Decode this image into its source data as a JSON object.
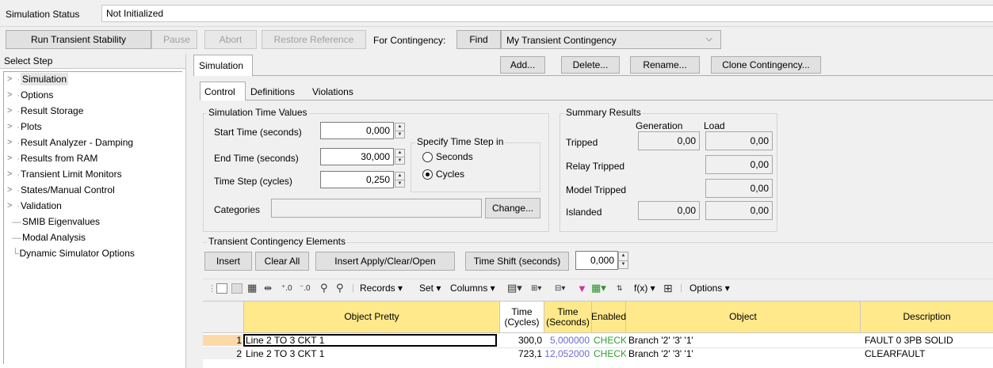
{
  "status": {
    "label": "Simulation Status",
    "value": "Not Initialized"
  },
  "toolbar": {
    "run": "Run Transient Stability",
    "pause": "Pause",
    "abort": "Abort",
    "restore": "Restore Reference",
    "for_contingency": "For Contingency:",
    "find": "Find",
    "contingency_value": "My Transient Contingency"
  },
  "select_step": {
    "title": "Select Step",
    "items": [
      "Simulation",
      "Options",
      "Result Storage",
      "Plots",
      "Result Analyzer - Damping",
      "Results from RAM",
      "Transient Limit Monitors",
      "States/Manual Control",
      "Validation",
      "SMIB Eigenvalues",
      "Modal Analysis",
      "Dynamic Simulator Options"
    ]
  },
  "main": {
    "tab": "Simulation",
    "add": "Add...",
    "delete": "Delete...",
    "rename": "Rename...",
    "clone": "Clone Contingency...",
    "subtabs": [
      "Control",
      "Definitions",
      "Violations"
    ]
  },
  "time_values": {
    "title": "Simulation Time Values",
    "start_label": "Start Time (seconds)",
    "start_value": "0,000",
    "end_label": "End Time (seconds)",
    "end_value": "30,000",
    "step_label": "Time Step (cycles)",
    "step_value": "0,250",
    "specify_title": "Specify Time Step in",
    "seconds": "Seconds",
    "cycles": "Cycles",
    "categories_label": "Categories",
    "change": "Change..."
  },
  "summary": {
    "title": "Summary Results",
    "col_generation": "Generation",
    "col_load": "Load",
    "tripped": "Tripped",
    "tripped_gen": "0,00",
    "tripped_load": "0,00",
    "relay": "Relay Tripped",
    "relay_load": "0,00",
    "model": "Model Tripped",
    "model_load": "0,00",
    "islanded": "Islanded",
    "islanded_gen": "0,00",
    "islanded_load": "0,00"
  },
  "elements": {
    "title": "Transient Contingency Elements",
    "insert": "Insert",
    "clear_all": "Clear All",
    "insert_apply": "Insert Apply/Clear/Open",
    "time_shift": "Time Shift (seconds)",
    "time_shift_value": "0,000"
  },
  "grid_toolbar": {
    "records": "Records ▾",
    "set": "Set ▾",
    "columns": "Columns ▾",
    "fx": "f(x) ▾",
    "options": "Options ▾"
  },
  "table": {
    "headers": {
      "object_pretty": "Object Pretty",
      "time_cycles": "Time (Cycles)",
      "time_seconds": "Time (Seconds)",
      "enabled": "Enabled",
      "object": "Object",
      "description": "Description"
    },
    "rows": [
      {
        "num": "1",
        "object_pretty": "Line 2  TO  3 CKT 1",
        "cycles": "300,0",
        "seconds": "5,000000",
        "enabled": "CHECK",
        "object": "Branch '2' '3' '1'",
        "description": "FAULT 0 3PB SOLID"
      },
      {
        "num": "2",
        "object_pretty": "Line 2  TO  3 CKT 1",
        "cycles": "723,1",
        "seconds": "12,052000",
        "enabled": "CHECK",
        "object": "Branch '2' '3' '1'",
        "description": "CLEARFAULT"
      }
    ]
  },
  "colors": {
    "check_green": "#2fa12f",
    "seconds_blue": "#6b6bd6",
    "header_yellow": "#ffe98b",
    "selected_row": "#fdd9a8"
  }
}
